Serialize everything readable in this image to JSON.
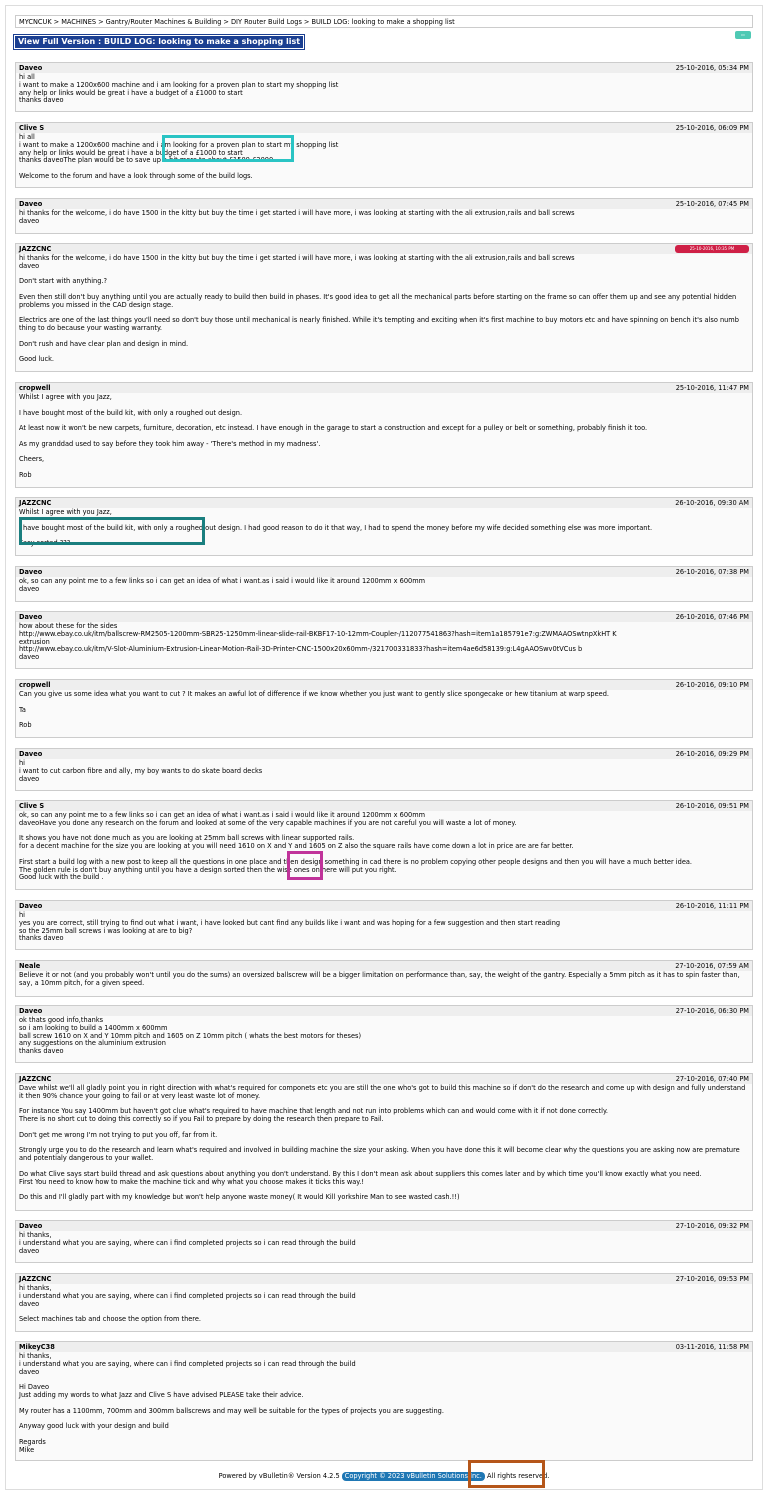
{
  "breadcrumb": {
    "items": [
      "MYCNCUK",
      "MACHINES",
      "Gantry/Router Machines & Building",
      "DIY Router Build Logs",
      "BUILD LOG: looking to make a shopping list"
    ],
    "separator": ">"
  },
  "full_version_label": "View Full Version : BUILD LOG: looking to make a shopping list",
  "posts": [
    {
      "author": "Daveo",
      "date": "25-10-2016, 05:34 PM",
      "body": "hi all\ni want to make a 1200x600 machine and i am looking for a proven plan to start my shopping list\nany help or links would be great i have a budget of a £1000 to start\nthanks daveo"
    },
    {
      "author": "Clive S",
      "date": "25-10-2016, 06:09 PM",
      "body": "hi all\ni want to make a 1200x600 machine and i am looking for a proven plan to start my shopping list\nany help or links would be great i have a budget of a £1000 to start\nthanks daveoThe plan would be to save up a bit more to about £1500-£2000\n\nWelcome to the forum and have a look through some of the build logs."
    },
    {
      "author": "Daveo",
      "date": "25-10-2016, 07:45 PM",
      "body": "hi thanks for the welcome, i do have 1500 in the kitty but buy the time i get started i will have more, i was looking at starting with the ali extrusion,rails and ball screws\ndaveo"
    },
    {
      "author": "JAZZCNC",
      "date": "25-10-2016, 10:35 PM",
      "body": "hi thanks for the welcome, i do have 1500 in the kitty but buy the time i get started i will have more, i was looking at starting with the ali extrusion,rails and ball screws\ndaveo\n\nDon't start with anything.?\n\nEven then still don't buy anything until you are actually ready to build then build in phases. It's good idea to get all the mechanical parts before starting on the frame so can offer them up and see any potential hidden problems you missed in the CAD design stage.\n\nElectrics are one of the last things you'll need so don't buy those until mechanical is nearly finished. While it's tempting and exciting when it's first machine to buy motors etc and have spinning on bench it's also numb thing to do because your wasting warranty.\n\nDon't rush and have clear plan and design in mind.\n\nGood luck."
    },
    {
      "author": "cropwell",
      "date": "25-10-2016, 11:47 PM",
      "body": "Whilst I agree with you Jazz,\n\nI have bought most of the build kit, with only a roughed out design.\n\nAt least now it won't be new carpets, furniture, decoration, etc instead. I have enough in the garage to start a construction and except for a pulley or belt or something, probably finish it too.\n\nAs my granddad used to say before they took him away - 'There's method in my madness'.\n\nCheers,\n\nRob"
    },
    {
      "author": "JAZZCNC",
      "date": "26-10-2016, 09:30 AM",
      "body": "Whilst I agree with you Jazz,\n\nI have bought most of the build kit, with only a roughed out design. I had good reason to do it that way, I had to spend the money before my wife decided something else was more important.\n\nEasy sorted.???"
    },
    {
      "author": "Daveo",
      "date": "26-10-2016, 07:38 PM",
      "body": "ok, so can any point me to a few links so i can get an idea of what i want.as i said i would like it around 1200mm x 600mm\ndaveo"
    },
    {
      "author": "Daveo",
      "date": "26-10-2016, 07:46 PM",
      "body": "how about these for the sides\nhttp://www.ebay.co.uk/itm/ballscrew-RM2505-1200mm-SBR25-1250mm-linear-slide-rail-BKBF17-10-12mm-Coupler-/112077541863?hash=item1a185791e7:g:ZWMAAOSwtnpXkHT K\nextrusion\nhttp://www.ebay.co.uk/itm/V-Slot-Aluminium-Extrusion-Linear-Motion-Rail-3D-Printer-CNC-1500x20x60mm-/321700331833?hash=item4ae6d58139:g:L4gAAOSwv0tVCus b\ndaveo"
    },
    {
      "author": "cropwell",
      "date": "26-10-2016, 09:10 PM",
      "body": "Can you give us some idea what you want to cut ? It makes an awful lot of difference if we know whether you just want to gently slice spongecake or hew titanium at warp speed.\n\nTa\n\nRob"
    },
    {
      "author": "Daveo",
      "date": "26-10-2016, 09:29 PM",
      "body": "hi\ni want to cut carbon fibre and ally, my boy wants to do skate board decks\ndaveo"
    },
    {
      "author": "Clive S",
      "date": "26-10-2016, 09:51 PM",
      "body": "ok, so can any point me to a few links so i can get an idea of what i want.as i said i would like it around 1200mm x 600mm\ndaveoHave you done any research on the forum and looked at some of the very capable machines if you are not careful you will waste a lot of money.\n\nIt shows you have not done much as you are looking at 25mm ball screws with linear supported rails.\nfor a decent machine for the size you are looking at you will need 1610 on X and Y and 1605 on Z also the square rails have come down a lot in price are are far better.\n\nFirst start a build log with a new post to keep all the questions in one place and then design something in cad there is no problem copying other people designs and then you will have a much better idea.\nThe golden rule is don't buy anything until you have a design sorted then the wise ones on here will put you right.\nGood luck with the build ."
    },
    {
      "author": "Daveo",
      "date": "26-10-2016, 11:11 PM",
      "body": "hi\nyes you are correct, still trying to find out what i want, i have looked but cant find any builds like i want and was hoping for a few suggestion and then start reading\nso the 25mm ball screws i was looking at are to big?\nthanks daveo"
    },
    {
      "author": "Neale",
      "date": "27-10-2016, 07:59 AM",
      "body": "Believe it or not (and you probably won't until you do the sums) an oversized ballscrew will be a bigger limitation on performance than, say, the weight of the gantry. Especially a 5mm pitch as it has to spin faster than, say, a 10mm pitch, for a given speed."
    },
    {
      "author": "Daveo",
      "date": "27-10-2016, 06:30 PM",
      "body": "ok thats good info,thanks\nso i am looking to build a 1400mm x 600mm\nball screw 1610 on X and Y 10mm pitch and 1605 on Z 10mm pitch ( whats the best motors for theses)\nany suggestions on the aluminium extrusion\nthanks daveo"
    },
    {
      "author": "JAZZCNC",
      "date": "27-10-2016, 07:40 PM",
      "body": "Dave whilst we'll all gladly point you in right direction with what's required for componets etc you are still the one who's got to build this machine so if don't do the research and come up with design and fully understand it then 90% chance your going to fail or at very least waste lot of money.\n\nFor instance You say 1400mm but haven't got clue what's required to have machine that length and not run into problems which can and would come with it if not done correctly.\nThere is no short cut to doing this correctly so if you Fail to prepare by doing the research then prepare to Fail.\n\nDon't get me wrong I'm not trying to put you off, far from it.\n\nStrongly urge you to do the research and learn what's required and involved in building machine the size your asking. When you have done this it will become clear why the questions you are asking now are premature and potentialy dangerous to your wallet.\n\nDo what Clive says start build thread and ask questions about anything you don't understand. By this I don't mean ask about suppliers this comes later and by which time you'll know exactly what you need.\nFirst You need to know how to make the machine tick and why what you choose makes it ticks this way.!\n\nDo this and I'll gladly part with my knowledge but won't help anyone waste money( It would Kill yorkshire Man to see wasted cash.!!)"
    },
    {
      "author": "Daveo",
      "date": "27-10-2016, 09:32 PM",
      "body": "hi thanks,\ni understand what you are saying, where can i find completed projects so i can read through the build\ndaveo"
    },
    {
      "author": "JAZZCNC",
      "date": "27-10-2016, 09:53 PM",
      "body": "hi thanks,\ni understand what you are saying, where can i find completed projects so i can read through the build\ndaveo\n\nSelect machines tab and choose the option from there."
    },
    {
      "author": "MikeyC38",
      "date": "03-11-2016, 11:58 PM",
      "body": "hi thanks,\ni understand what you are saying, where can i find completed projects so i can read through the build\ndaveo\n\nHi Daveo\nJust adding my words to what Jazz and Clive S have advised PLEASE take their advice.\n\nMy router has a 1100mm, 700mm and 300mm ballscrews and may well be suitable for the types of projects you are suggesting.\n\nAnyway good luck with your design and build\n\nRegards\nMike"
    }
  ],
  "footer": {
    "powered_by": "Powered by vBulletin® Version 4.2.5",
    "copyright": "Copyright © 2023 vBulletin Solutions Inc.",
    "rights": "All rights reserved."
  },
  "colors": {
    "full_version_bg": "#1b3f91",
    "badge_bg": "#cf2046",
    "copyright_bg": "#1f77b4",
    "mark_cyan": "#2ac4c4",
    "mark_teal": "#1a7f7f",
    "mark_magenta": "#c0339a",
    "mark_orange": "#b5561a"
  }
}
